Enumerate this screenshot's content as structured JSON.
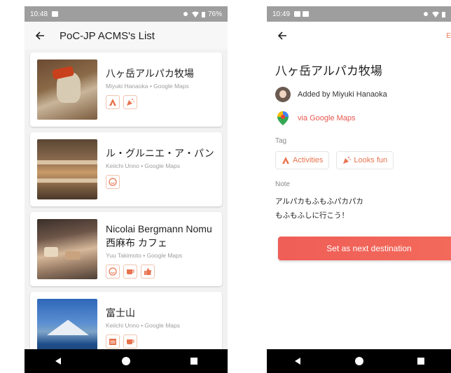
{
  "colors": {
    "accent": "#e8574f",
    "tag_orange": "#e8734f",
    "statusbar": "#9e9e9e",
    "navbar": "#000000"
  },
  "left": {
    "status": {
      "time": "10:48",
      "battery": "76%"
    },
    "appbar": {
      "title": "PoC-JP ACMS's List"
    },
    "cards": [
      {
        "title": "八ヶ岳アルパカ牧場",
        "sub": "Miyuki Hanaoka • Google Maps",
        "tags": [
          "activities-icon",
          "confetti-icon"
        ]
      },
      {
        "title": "ル・グルニエ・ア・パン",
        "sub": "Keiichi Unno • Google Maps",
        "tags": [
          "smiley-icon"
        ]
      },
      {
        "title": "Nicolai Bergmann Nomu 西麻布 カフェ",
        "sub": "Yuu Takimoto • Google Maps",
        "tags": [
          "smiley-icon",
          "cup-icon",
          "thumbs-up-icon"
        ]
      },
      {
        "title": "富士山",
        "sub": "Keiichi Unno • Google Maps",
        "tags": [
          "calendar-icon",
          "cup-icon"
        ]
      }
    ]
  },
  "right": {
    "status": {
      "time": "10:49"
    },
    "appbar": {
      "edit_partial": "E"
    },
    "detail": {
      "title": "八ヶ岳アルパカ牧場",
      "added_by": "Added by Miyuki Hanaoka",
      "via": "via Google Maps",
      "tag_label": "Tag",
      "tags": [
        "Activities",
        "Looks fun"
      ],
      "note_label": "Note",
      "note_line1": "アルパカもふもふパカパカ",
      "note_line2": "もふもふしに行こう！",
      "cta": "Set as next destination"
    }
  }
}
